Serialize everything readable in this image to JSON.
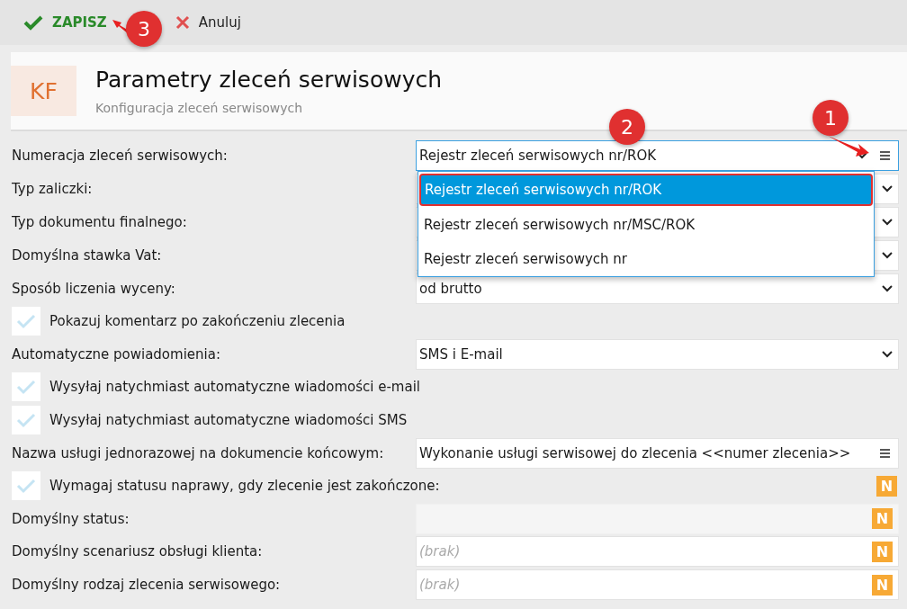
{
  "toolbar": {
    "save": "ZAPISZ",
    "cancel": "Anuluj"
  },
  "header": {
    "logo": "KF",
    "title": "Parametry zleceń serwisowych",
    "subtitle": "Konfiguracja zleceń serwisowych"
  },
  "rows": [
    {
      "kind": "select",
      "label": "Numeracja zleceń serwisowych:",
      "value": "Rejestr zleceń serwisowych nr/ROK",
      "focused": true,
      "menu": true
    },
    {
      "kind": "select",
      "label": "Typ zaliczki:",
      "focused": false,
      "menu": false
    },
    {
      "kind": "select",
      "label": "Typ dokumentu finalnego:",
      "focused": false,
      "menu": false
    },
    {
      "kind": "select",
      "label": "Domyślna stawka Vat:",
      "focused": false,
      "menu": false
    },
    {
      "kind": "select",
      "label": "Sposób liczenia wyceny:",
      "value": "od brutto",
      "focused": false,
      "menu": false
    },
    {
      "kind": "checkbox",
      "label": "Pokazuj komentarz po zakończeniu zlecenia",
      "checked": false
    },
    {
      "kind": "select",
      "label": "Automatyczne powiadomienia:",
      "value": "SMS i E-mail",
      "focused": false,
      "menu": false
    },
    {
      "kind": "checkbox",
      "label": "Wysyłaj natychmiast automatyczne wiadomości e-mail",
      "checked": false
    },
    {
      "kind": "checkbox",
      "label": "Wysyłaj natychmiast automatyczne wiadomości SMS",
      "checked": false
    },
    {
      "kind": "text",
      "label": "Nazwa usługi jednorazowej na dokumencie końcowym:",
      "value": "Wykonanie usługi serwisowej do zlecenia <<numer zlecenia>>",
      "menu": true
    },
    {
      "kind": "checkbox",
      "label": "Wymagaj statusu naprawy, gdy zlecenie jest zakończone:",
      "checked": false,
      "badge": "N"
    },
    {
      "kind": "lookup",
      "label": "Domyślny status:",
      "disabled": true,
      "badge": "N"
    },
    {
      "kind": "lookup",
      "label": "Domyślny scenariusz obsługi klienta:",
      "placeholder": "(brak)",
      "disabled": false,
      "badge": "N"
    },
    {
      "kind": "lookup",
      "label": "Domyślny rodzaj zlecenia serwisowego:",
      "placeholder": "(brak)",
      "disabled": false,
      "badge": "N"
    }
  ],
  "dropdown": {
    "options": [
      {
        "label": "Rejestr zleceń serwisowych nr/ROK",
        "selected": true
      },
      {
        "label": "Rejestr zleceń serwisowych nr/MSC/ROK",
        "selected": false
      },
      {
        "label": "Rejestr zleceń serwisowych nr",
        "selected": false
      }
    ]
  },
  "callouts": [
    {
      "number": "1"
    },
    {
      "number": "2"
    },
    {
      "number": "3"
    }
  ]
}
